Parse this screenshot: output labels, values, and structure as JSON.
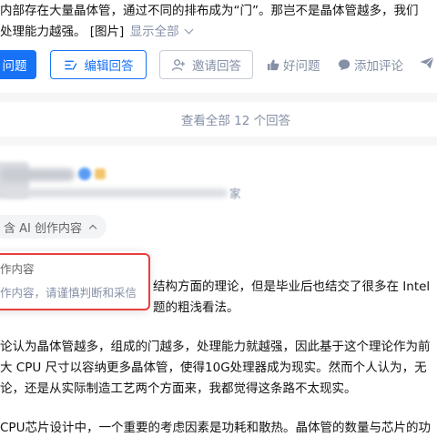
{
  "question": {
    "description_line1": "内部存在大量晶体管，通过不同的排布成为“门”。那岂不是晶体管越多，我们",
    "description_line2": "处理能力越强。 [图片]",
    "show_all_label": "显示全部"
  },
  "actions": {
    "answer_label": "问题",
    "edit_answer_label": "编辑回答",
    "invite_label": "邀请回答",
    "good_question_label": "好问题",
    "add_comment_label": "添加评论"
  },
  "view_all": {
    "label": "查看全部 12 个回答"
  },
  "answer": {
    "author_bio_tail": "家",
    "ai_tag_label": "含 AI 创作内容",
    "ai_popover": {
      "title": "作内容",
      "description": "作内容，请谨慎判断和采信"
    },
    "paragraphs": {
      "p1_line1": "结构方面的理论，但是毕业后也结交了很多在 Intel",
      "p1_line2": "题的粗浅看法。",
      "p2_line1": "论认为晶体管越多，组成的门越多，处理能力就越强，因此基于这个理论作为前",
      "p2_line2": "大 CPU 尺寸以容纳更多晶体管，使得10G处理器成为现实。然而个人认为，无",
      "p2_line3": "论，还是从实际制造工艺两个方面来，我都觉得这条路不太现实。",
      "p3_line1": "CPU芯片设计中，一个重要的考虑因素是功耗和散热。晶体管的数量与芯片的功"
    }
  },
  "colors": {
    "primary": "#1772f6",
    "muted": "#8590a6",
    "highlight_border": "#e8403d"
  }
}
